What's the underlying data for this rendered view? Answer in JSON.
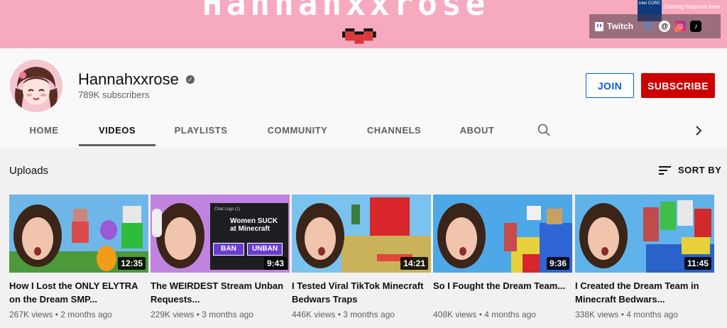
{
  "banner": {
    "title": "Hannahxxrose",
    "twitch_label": "Twitch",
    "ad_badge": "intel CORE",
    "ad_text": "Gaming happens here",
    "social_icons": [
      "twitter-icon",
      "threads-icon",
      "instagram-icon",
      "tiktok-icon"
    ]
  },
  "channel": {
    "name": "Hannahxxrose",
    "verified_icon": "checkmark-icon",
    "subscribers": "789K subscribers",
    "join_label": "JOIN",
    "subscribe_label": "SUBSCRIBE"
  },
  "tabs": [
    "HOME",
    "VIDEOS",
    "PLAYLISTS",
    "COMMUNITY",
    "CHANNELS",
    "ABOUT"
  ],
  "active_tab": "VIDEOS",
  "section": {
    "title": "Uploads",
    "sort_label": "SORT BY"
  },
  "videos": [
    {
      "title": "How I Lost the ONLY ELYTRA on the Dream SMP...",
      "views": "267K views",
      "age": "2 months ago",
      "duration": "12:35"
    },
    {
      "title": "The WEIRDEST Stream Unban Requests...",
      "views": "229K views",
      "age": "3 months ago",
      "duration": "9:43",
      "overlay": {
        "header": "Chat Logs (1)",
        "message": "Women SUCK at Minecraft",
        "ban": "BAN",
        "unban": "UNBAN"
      }
    },
    {
      "title": "I Tested Viral TikTok Minecraft Bedwars Traps",
      "views": "446K views",
      "age": "3 months ago",
      "duration": "14:21"
    },
    {
      "title": "So I Fought the Dream Team...",
      "views": "408K views",
      "age": "4 months ago",
      "duration": "9:36"
    },
    {
      "title": "I Created the Dream Team in Minecraft Bedwars...",
      "views": "338K views",
      "age": "4 months ago",
      "duration": "11:45"
    }
  ],
  "colors": {
    "banner": "#f7a9c0",
    "subscribe": "#cc0000",
    "join": "#065fd4"
  }
}
